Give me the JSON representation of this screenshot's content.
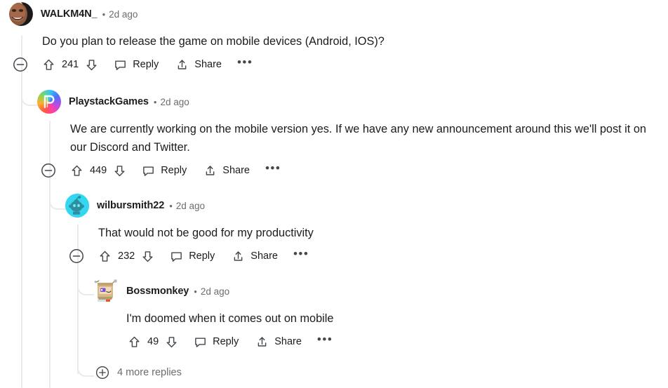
{
  "thread": {
    "comments": [
      {
        "id": "c0",
        "username": "WALKM4N_",
        "separator": "•",
        "timestamp": "2d ago",
        "body": "Do you plan to release the game on mobile devices (Android, IOS)?",
        "votes": "241",
        "reply_label": "Reply",
        "share_label": "Share",
        "has_collapse": true,
        "avatar": "meme-face-avatar"
      },
      {
        "id": "c1",
        "username": "PlaystackGames",
        "separator": "•",
        "timestamp": "2d ago",
        "body": "We are currently working on the mobile version yes. If we have any new announcement around this we'll post it on our Discord and Twitter.",
        "votes": "449",
        "reply_label": "Reply",
        "share_label": "Share",
        "has_collapse": true,
        "avatar": "playstack-logo-avatar"
      },
      {
        "id": "c2",
        "username": "wilbursmith22",
        "separator": "•",
        "timestamp": "2d ago",
        "body": "That would not be good for my productivity",
        "votes": "232",
        "reply_label": "Reply",
        "share_label": "Share",
        "has_collapse": true,
        "avatar": "snoo-cyan-avatar"
      },
      {
        "id": "c3",
        "username": "Bossmonkey",
        "separator": "•",
        "timestamp": "2d ago",
        "body": "I'm doomed when it comes out on mobile",
        "votes": "49",
        "reply_label": "Reply",
        "share_label": "Share",
        "has_collapse": false,
        "avatar": "box-robot-avatar"
      }
    ],
    "more_replies_label": "4 more replies",
    "overflow_glyph": "•••"
  },
  "colors": {
    "text": "#1c1c1c",
    "muted": "#6a6d70",
    "thread_line": "#e9eaec",
    "icon": "#42474c",
    "page_background": "#ffffff"
  }
}
